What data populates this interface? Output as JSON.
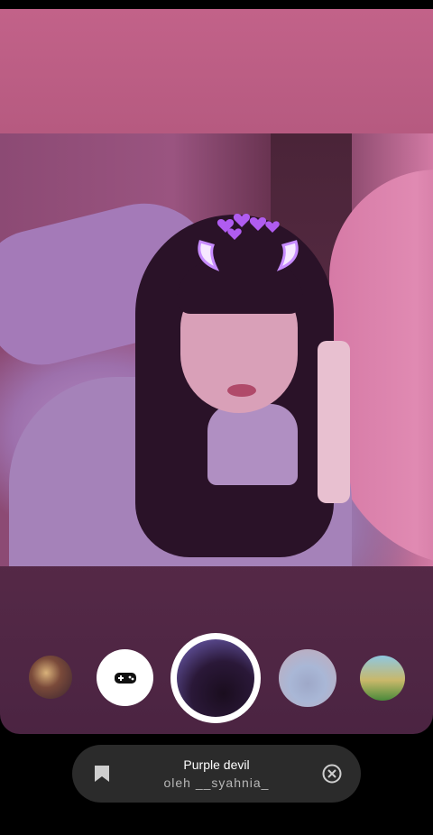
{
  "filter": {
    "name": "Purple devil",
    "author": "oleh __syahnia_"
  },
  "carousel": {
    "items": [
      {
        "name": "filter-thumb-1"
      },
      {
        "name": "filter-thumb-game"
      },
      {
        "name": "filter-thumb-purple-devil",
        "selected": true
      },
      {
        "name": "filter-thumb-4"
      },
      {
        "name": "filter-thumb-5"
      }
    ]
  },
  "icons": {
    "save": "bookmark-icon",
    "close": "close-circle-icon",
    "game": "gamepad-icon"
  },
  "colors": {
    "accent": "#ffffff",
    "sheet_bg": "#2b2b2b",
    "camera_top": "#c26289",
    "camera_bottom": "#4b2442"
  }
}
